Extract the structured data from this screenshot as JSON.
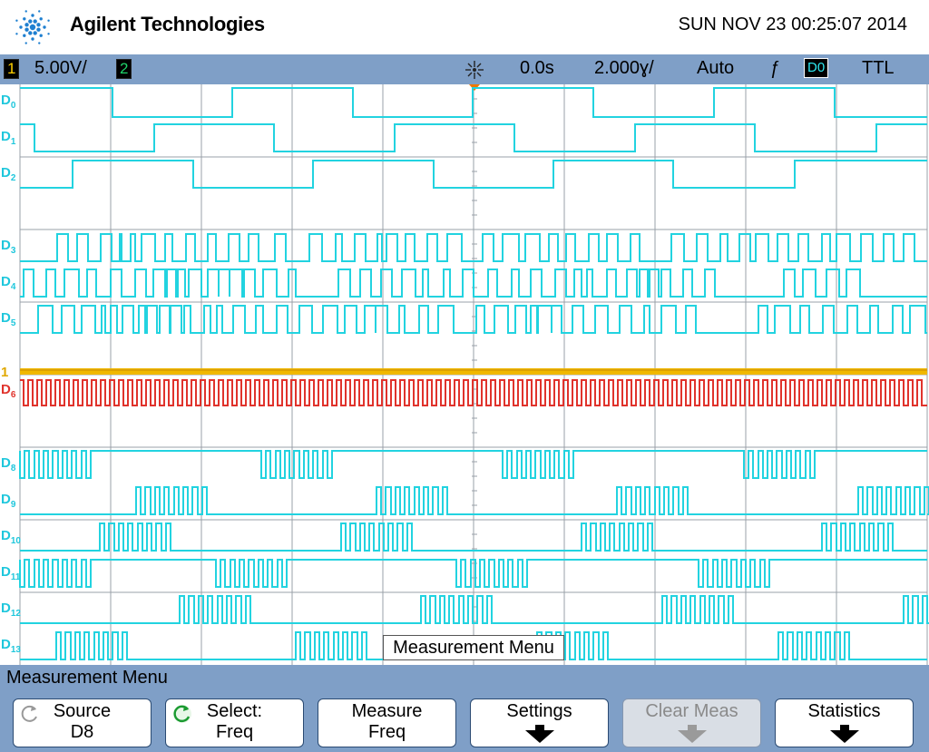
{
  "brand": "Agilent Technologies",
  "datetime": "SUN NOV 23 00:25:07 2014",
  "status": {
    "ch1_number": "1",
    "ch1_scale": "5.00V/",
    "ch2_number": "2",
    "delay": "0.0s",
    "timebase": "2.000ɣ/",
    "trigger_mode": "Auto",
    "trigger_slope_symbol": "ƒ",
    "trigger_source": "D0",
    "trigger_level": "TTL"
  },
  "channels": [
    {
      "id": "D0",
      "num": "0"
    },
    {
      "id": "D1",
      "num": "1"
    },
    {
      "id": "D2",
      "num": "2"
    },
    {
      "id": "D3",
      "num": "3"
    },
    {
      "id": "D4",
      "num": "4"
    },
    {
      "id": "D5",
      "num": "5"
    },
    {
      "id": "D6",
      "num": "6"
    },
    {
      "id": "D8",
      "num": "8"
    },
    {
      "id": "D9",
      "num": "9"
    },
    {
      "id": "D10",
      "num": "10"
    },
    {
      "id": "D11",
      "num": "11"
    },
    {
      "id": "D12",
      "num": "12"
    },
    {
      "id": "D13",
      "num": "13"
    }
  ],
  "analog_marker": "1",
  "popup": "Measurement Menu",
  "menu_title": "Measurement Menu",
  "softkeys": {
    "source": {
      "l1": "Source",
      "l2": "D8"
    },
    "select": {
      "l1": "Select:",
      "l2": "Freq"
    },
    "measure": {
      "l1": "Measure",
      "l2": "Freq"
    },
    "settings": {
      "l1": "Settings"
    },
    "clear": {
      "l1": "Clear Meas"
    },
    "statistics": {
      "l1": "Statistics"
    }
  },
  "colors": {
    "digital": "#22d3e0",
    "ch1": "#f0b800",
    "d6": "#e0332c",
    "status_bar": "#7f9fc7",
    "grid": "#9aa0a8"
  }
}
